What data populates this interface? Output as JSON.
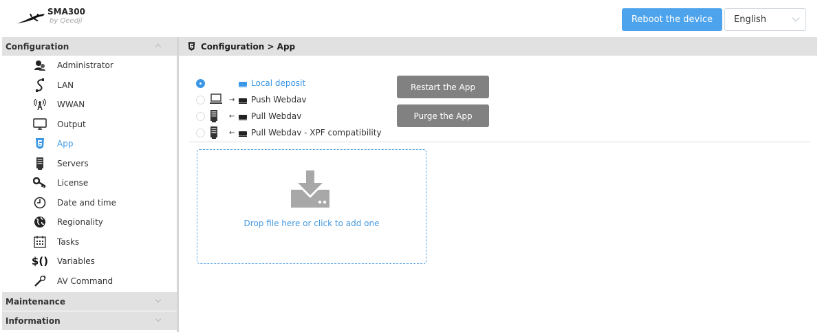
{
  "app": {
    "name": "SMA300",
    "vendor": "by Qeedji"
  },
  "header": {
    "reboot_label": "Reboot the device",
    "language": "English"
  },
  "sidebar": {
    "configuration_label": "Configuration",
    "items": [
      {
        "label": "Administrator",
        "icon": "administrator-icon"
      },
      {
        "label": "LAN",
        "icon": "lan-cable-icon"
      },
      {
        "label": "WWAN",
        "icon": "antenna-icon"
      },
      {
        "label": "Output",
        "icon": "monitor-icon"
      },
      {
        "label": "App",
        "icon": "html5-icon",
        "active": true
      },
      {
        "label": "Servers",
        "icon": "server-icon"
      },
      {
        "label": "License",
        "icon": "key-icon"
      },
      {
        "label": "Date and time",
        "icon": "clock-icon"
      },
      {
        "label": "Regionality",
        "icon": "globe-icon"
      },
      {
        "label": "Tasks",
        "icon": "calendar-icon"
      },
      {
        "label": "Variables",
        "icon": "variables-icon"
      },
      {
        "label": "AV Command",
        "icon": "microphone-icon"
      }
    ],
    "maintenance_label": "Maintenance",
    "information_label": "Information"
  },
  "main": {
    "breadcrumb": "Configuration > App",
    "deposit_options": [
      {
        "label": "Local deposit",
        "selected": true
      },
      {
        "label": "Push Webdav",
        "selected": false
      },
      {
        "label": "Pull Webdav",
        "selected": false
      },
      {
        "label": "Pull Webdav - XPF compatibility",
        "selected": false
      }
    ],
    "restart_label": "Restart the App",
    "purge_label": "Purge the App",
    "dropzone_text": "Drop file here or click to add one"
  },
  "colors": {
    "accent": "#3a97e6",
    "button_blue": "#4da3ec",
    "button_gray": "#818181",
    "section_bg": "#e1e1e1"
  }
}
